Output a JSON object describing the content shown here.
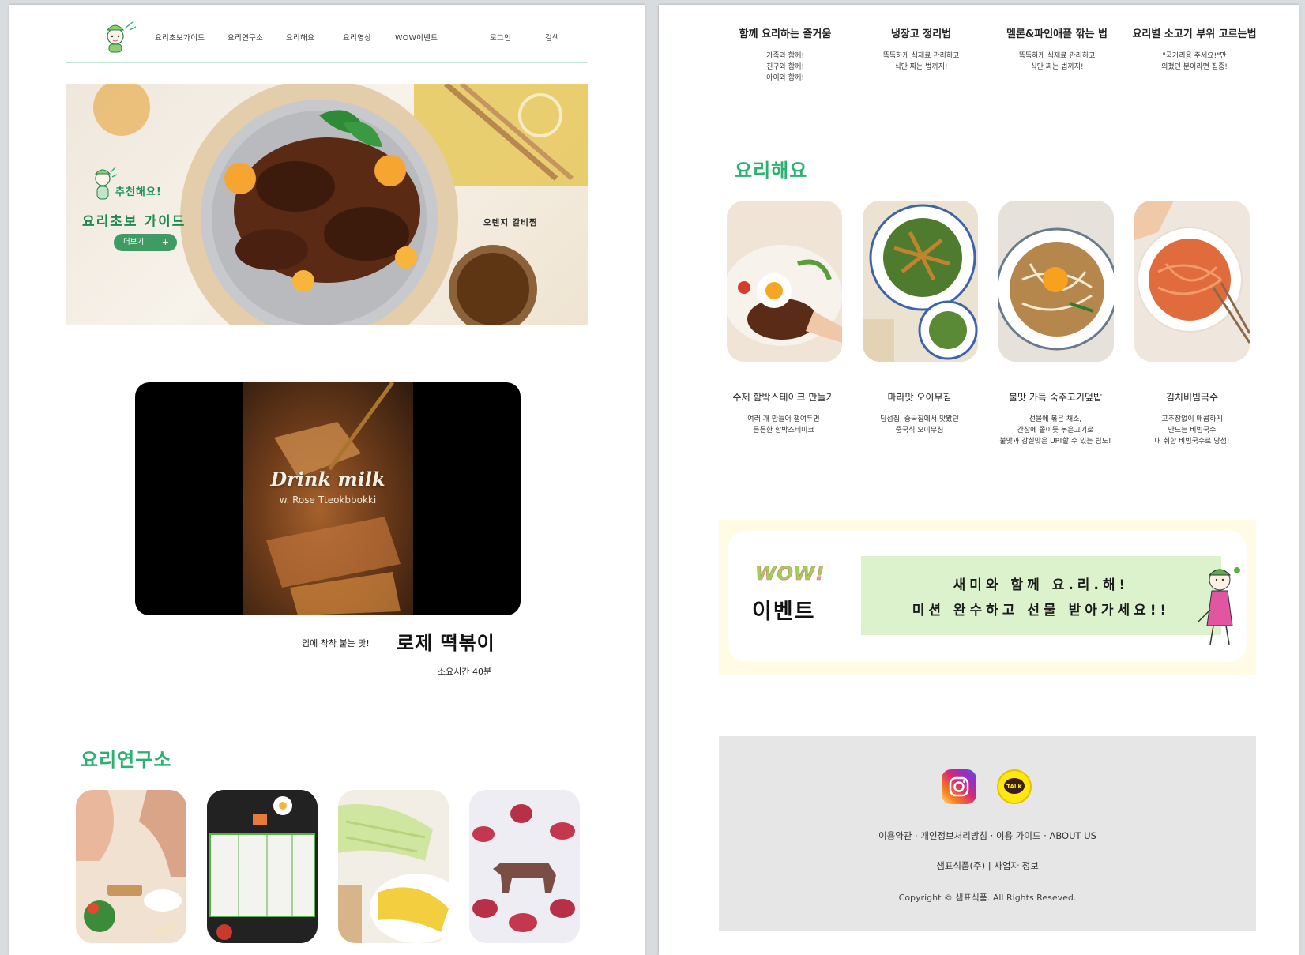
{
  "nav": {
    "items": [
      "요리초보가이드",
      "요리연구소",
      "요리해요",
      "요리영상",
      "WOW이벤트",
      "로그인",
      "검색"
    ]
  },
  "hero": {
    "subtitle": "추천해요!",
    "title": "요리초보 가이드",
    "more_button": "더보기",
    "more_plus": "+",
    "dish_name": "오렌지 갈비찜"
  },
  "video": {
    "title": "Drink milk",
    "subtitle": "w. Rose Tteokbbokki"
  },
  "feature": {
    "tagline": "입에 착착 붙는 맛!",
    "title": "로제 떡볶이",
    "time": "소요시간 40분"
  },
  "lab": {
    "section_title": "요리연구소"
  },
  "tips": [
    {
      "title": "함께 요리하는 즐거움",
      "desc": "가족과 함께!\n친구와 함께!\n아이와 함께!"
    },
    {
      "title": "냉장고 정리법",
      "desc": "똑똑하게 식재료 관리하고\n식단 짜는 법까지!"
    },
    {
      "title": "멜론&파인애플 깎는 법",
      "desc": "똑똑하게 식재료 관리하고\n식단 짜는 법까지!"
    },
    {
      "title": "요리별 소고기 부위 고르는법",
      "desc": "\"국거리용 주세요!\"만\n외쳤던 분이라면 집중!"
    }
  ],
  "cook": {
    "section_title": "요리해요",
    "recipes": [
      {
        "title": "수제 함박스테이크 만들기",
        "desc": "여러 개 만들어 쟁여두면\n든든한 함박스테이크"
      },
      {
        "title": "마라맛 오이무침",
        "desc": "딤섬집, 중국집에서 맛봤던\n중국식 오이무침"
      },
      {
        "title": "불맛 가득 숙주고기덮밥",
        "desc": "선물에 볶은 채소,\n간장에 졸이듯 볶은고기로\n불맛과 감칠맛은 UP!할 수 있는 팁도!"
      },
      {
        "title": "김치비빔국수",
        "desc": "고추장없이 매콤하게\n만드는 비빔국수\n내 취향 비빔국수로 당첨!"
      }
    ]
  },
  "event": {
    "wow": "WOW!",
    "label": "이벤트",
    "line1": "새미와 함께 요.리.해!",
    "line2": "미션 완수하고 선물 받아가세요!!"
  },
  "footer": {
    "kakao_label": "TALK",
    "links": "이용약관 · 개인정보처리방침 · 이용 가이드 · ABOUT US",
    "corp": "샘표식품(주)   |   사업자 정보",
    "copyright": "Copyright © 샘표식품.  All Rights Reseved."
  },
  "colors": {
    "brand_green": "#2bb272",
    "button_green": "#3e9b63",
    "event_bg": "#fffbe4",
    "banner_green": "#dcf2cd",
    "footer_bg": "#e6e6e6"
  }
}
